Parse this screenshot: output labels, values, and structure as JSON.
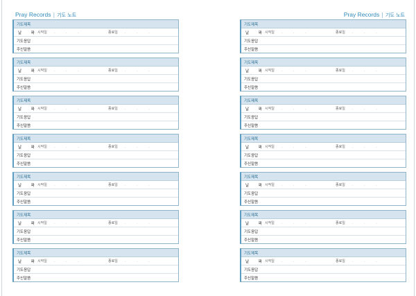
{
  "header": {
    "title": "Pray Records",
    "separator": "|",
    "subtitle": "기도 노트"
  },
  "labels": {
    "prayer_title": "기도제목",
    "date": "날  짜",
    "start_date": "시작일",
    "end_date": "종료일",
    "answer": "기도응답",
    "word": "주신말씀",
    "date_dots": ". . ."
  },
  "pages": [
    {
      "side": "left",
      "record_count": 7
    },
    {
      "side": "right",
      "record_count": 7
    }
  ]
}
